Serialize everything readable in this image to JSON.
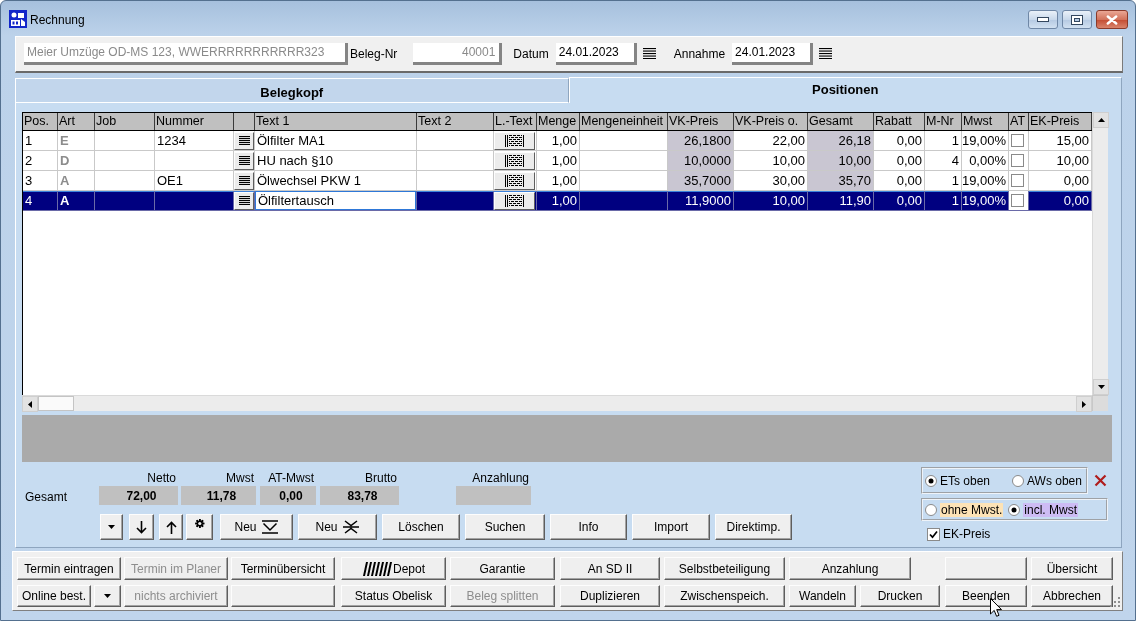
{
  "window": {
    "title": "Rechnung"
  },
  "header": {
    "fields": [
      {
        "kind": "text",
        "value": "Meier Umzüge OD-MS 123, WWERRRRRRRRRRR323",
        "disabled": true
      },
      {
        "kind": "number",
        "label": "Beleg-Nr",
        "value": "40001",
        "disabled": true
      },
      {
        "kind": "date",
        "label": "Datum",
        "value": "24.01.2023",
        "disabled": false
      },
      {
        "kind": "date",
        "label": "Annahme",
        "value": "24.01.2023",
        "disabled": false
      }
    ]
  },
  "tabs": [
    {
      "label": "Belegkopf",
      "selected": false
    },
    {
      "label": "Positionen",
      "selected": true
    }
  ],
  "table": {
    "columns": [
      {
        "label": "Pos.",
        "kind": "text"
      },
      {
        "label": "Art",
        "kind": "code"
      },
      {
        "label": "Job",
        "kind": "text"
      },
      {
        "label": "Nummer",
        "kind": "text"
      },
      {
        "kind": "list_button"
      },
      {
        "label": "Text 1",
        "kind": "text"
      },
      {
        "label": "Text 2",
        "kind": "text"
      },
      {
        "label": "L.-Text",
        "kind": "text_button"
      },
      {
        "label": "Menge",
        "kind": "number"
      },
      {
        "label": "Mengeneinheit",
        "kind": "text"
      },
      {
        "label": "VK-Preis",
        "kind": "calculated"
      },
      {
        "label": "VK-Preis o.",
        "kind": "number"
      },
      {
        "label": "Gesamt",
        "kind": "calculated"
      },
      {
        "label": "Rabatt",
        "kind": "number"
      },
      {
        "label": "M-Nr",
        "kind": "number"
      },
      {
        "label": "Mwst",
        "kind": "number"
      },
      {
        "label": "AT",
        "kind": "check"
      },
      {
        "label": "EK-Preis",
        "kind": "number"
      }
    ],
    "rows": [
      {
        "selected": false,
        "cells": [
          {
            "text": "1"
          },
          {
            "text": "E"
          },
          {},
          {
            "text": "1234"
          },
          {},
          {
            "text": "Ölfilter MA1"
          },
          {},
          {},
          {
            "text": "1,00"
          },
          {},
          {
            "text": "26,1800"
          },
          {
            "text": "22,00"
          },
          {
            "text": "26,18"
          },
          {
            "text": "0,00"
          },
          {
            "text": "1"
          },
          {
            "text": "19,00%"
          },
          {
            "checked": false
          },
          {
            "text": "15,00"
          }
        ]
      },
      {
        "selected": false,
        "cells": [
          {
            "text": "2"
          },
          {
            "text": "D"
          },
          {},
          {},
          {},
          {
            "text": "HU nach §10"
          },
          {},
          {},
          {
            "text": "1,00"
          },
          {},
          {
            "text": "10,0000"
          },
          {
            "text": "10,00"
          },
          {
            "text": "10,00"
          },
          {
            "text": "0,00"
          },
          {
            "text": "4"
          },
          {
            "text": "0,00%"
          },
          {
            "checked": false
          },
          {
            "text": "10,00"
          }
        ]
      },
      {
        "selected": false,
        "cells": [
          {
            "text": "3"
          },
          {
            "text": "A"
          },
          {},
          {
            "text": "OE1"
          },
          {},
          {
            "text": "Ölwechsel PKW 1"
          },
          {},
          {},
          {
            "text": "1,00"
          },
          {},
          {
            "text": "35,7000"
          },
          {
            "text": "30,00"
          },
          {
            "text": "35,70"
          },
          {
            "text": "0,00"
          },
          {
            "text": "1"
          },
          {
            "text": "19,00%"
          },
          {
            "checked": false
          },
          {
            "text": "0,00"
          }
        ]
      },
      {
        "selected": true,
        "cells": [
          {
            "text": "4"
          },
          {
            "text": "A"
          },
          {},
          {},
          {},
          {
            "text": "Ölfiltertausch",
            "editing": true
          },
          {},
          {},
          {
            "text": "1,00"
          },
          {},
          {
            "text": "11,9000"
          },
          {
            "text": "10,00"
          },
          {
            "text": "11,90"
          },
          {
            "text": "0,00"
          },
          {
            "text": "1"
          },
          {
            "text": "19,00%"
          },
          {
            "checked": false
          },
          {
            "text": "0,00"
          }
        ]
      }
    ]
  },
  "totals": {
    "label": "Gesamt",
    "items": [
      {
        "label": "Netto",
        "value": "72,00"
      },
      {
        "label": "Mwst",
        "value": "11,78"
      },
      {
        "label": "AT-Mwst",
        "value": "0,00"
      },
      {
        "label": "Brutto",
        "value": "83,78"
      },
      {
        "label": "Anzahlung"
      }
    ]
  },
  "edit_buttons": [
    {
      "kind": "menu"
    },
    {
      "kind": "move_down"
    },
    {
      "kind": "move_up"
    },
    {
      "kind": "options"
    },
    {
      "kind": "new_below",
      "label": "Neu"
    },
    {
      "kind": "new_between",
      "label": "Neu"
    },
    {
      "kind": "text",
      "label": "Löschen"
    },
    {
      "kind": "text",
      "label": "Suchen"
    },
    {
      "kind": "text",
      "label": "Info"
    },
    {
      "kind": "text",
      "label": "Import"
    },
    {
      "kind": "text",
      "label": "Direktimp."
    }
  ],
  "sort_options": [
    {
      "label": "ETs oben",
      "selected": true
    },
    {
      "label": "AWs oben",
      "selected": false
    }
  ],
  "tax_options": [
    {
      "label": "ohne Mwst.",
      "selected": false,
      "color": "#fde3b6"
    },
    {
      "label": "incl. Mwst",
      "selected": true,
      "color": "#cdbcf4"
    }
  ],
  "ek_preis": {
    "label": "EK-Preis",
    "checked": true
  },
  "action_rows": [
    [
      {
        "kind": "text",
        "label": "Termin eintragen",
        "disabled": false
      },
      {
        "kind": "text",
        "label": "Termin im Planer",
        "disabled": true
      },
      {
        "kind": "text",
        "label": "Terminübersicht",
        "disabled": false
      },
      {
        "kind": "icon_text",
        "label": "Depot",
        "disabled": false
      },
      {
        "kind": "text",
        "label": "Garantie",
        "disabled": false
      },
      {
        "kind": "text",
        "label": "An SD II",
        "disabled": false
      },
      {
        "kind": "text",
        "label": "Selbstbeteiligung",
        "disabled": false
      },
      {
        "kind": "text",
        "label": "Anzahlung",
        "disabled": false
      },
      {
        "kind": "blank"
      },
      {
        "kind": "text",
        "label": "Übersicht",
        "disabled": false
      }
    ],
    [
      {
        "kind": "text",
        "label": "Online best.",
        "disabled": false
      },
      {
        "kind": "menu",
        "disabled": false
      },
      {
        "kind": "text",
        "label": "nichts archiviert",
        "disabled": true
      },
      {
        "kind": "blank"
      },
      {
        "kind": "text",
        "label": "Status Obelisk",
        "disabled": false
      },
      {
        "kind": "text",
        "label": "Beleg splitten",
        "disabled": true
      },
      {
        "kind": "text",
        "label": "Duplizieren",
        "disabled": false
      },
      {
        "kind": "text",
        "label": "Zwischenspeich.",
        "disabled": false
      },
      {
        "kind": "text",
        "label": "Wandeln",
        "disabled": false
      },
      {
        "kind": "text",
        "label": "Drucken",
        "disabled": false
      },
      {
        "kind": "text",
        "label": "Beenden",
        "disabled": false
      },
      {
        "kind": "text",
        "label": "Abbrechen",
        "disabled": false
      }
    ]
  ]
}
